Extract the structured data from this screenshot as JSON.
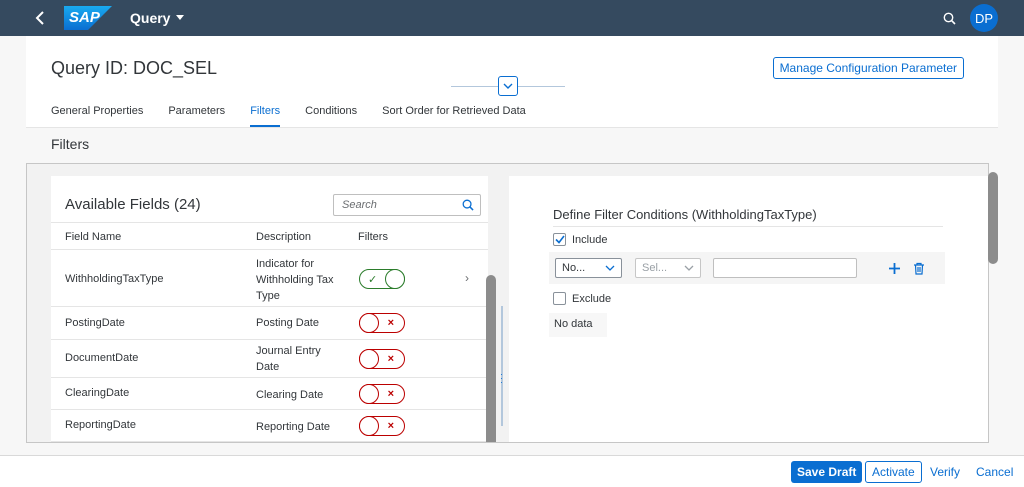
{
  "shell": {
    "logo_text": "SAP",
    "app_title": "Query",
    "avatar_initials": "DP"
  },
  "header": {
    "title": "Query ID: DOC_SEL",
    "manage_button": "Manage Configuration Parameter",
    "tabs": [
      "General Properties",
      "Parameters",
      "Filters",
      "Conditions",
      "Sort Order for Retrieved Data"
    ],
    "active_tab": "Filters"
  },
  "section": {
    "title": "Filters"
  },
  "available_fields": {
    "title": "Available Fields (24)",
    "search_placeholder": "Search",
    "columns": [
      "Field Name",
      "Description",
      "Filters"
    ],
    "rows": [
      {
        "field": "WithholdingTaxType",
        "description": "Indicator for Withholding Tax Type",
        "filter_on": true
      },
      {
        "field": "PostingDate",
        "description": "Posting Date",
        "filter_on": false
      },
      {
        "field": "DocumentDate",
        "description": "Journal Entry Date",
        "filter_on": false
      },
      {
        "field": "ClearingDate",
        "description": "Clearing Date",
        "filter_on": false
      },
      {
        "field": "ReportingDate",
        "description": "Reporting Date",
        "filter_on": false
      }
    ]
  },
  "filter_conditions": {
    "title": "Define Filter Conditions (WithholdingTaxType)",
    "include_label": "Include",
    "include_checked": true,
    "operator_value": "No...",
    "selector_value": "Sel...",
    "exclude_label": "Exclude",
    "exclude_checked": false,
    "no_data_text": "No data"
  },
  "footer": {
    "save_draft": "Save Draft",
    "activate": "Activate",
    "verify": "Verify",
    "cancel": "Cancel"
  },
  "colors": {
    "shell_bg": "#354a5f",
    "accent": "#0a6ed1",
    "positive": "#2b7c2b",
    "negative": "#bb0000"
  }
}
